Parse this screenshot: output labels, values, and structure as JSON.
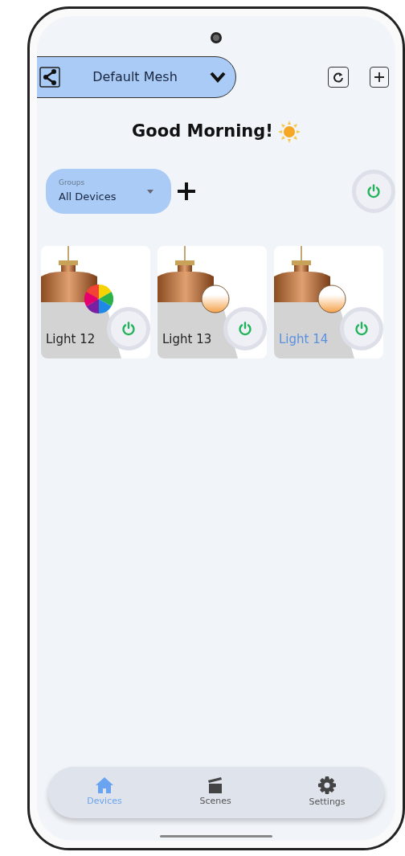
{
  "mesh_selector": {
    "label": "Default Mesh"
  },
  "greeting": "Good Morning!",
  "groups_dropdown": {
    "label": "Groups",
    "value": "All Devices"
  },
  "master_power": {
    "on": true
  },
  "devices": [
    {
      "name": "Light 12",
      "kind": "rgb",
      "on": true,
      "selected": false
    },
    {
      "name": "Light 13",
      "kind": "tunable",
      "on": true,
      "selected": false
    },
    {
      "name": "Light 14",
      "kind": "tunable",
      "on": true,
      "selected": true
    }
  ],
  "nav_tabs": [
    {
      "label": "Devices",
      "kind": "home",
      "selected": true
    },
    {
      "label": "Scenes",
      "kind": "scenes",
      "selected": false
    },
    {
      "label": "Settings",
      "kind": "settings",
      "selected": false
    }
  ]
}
